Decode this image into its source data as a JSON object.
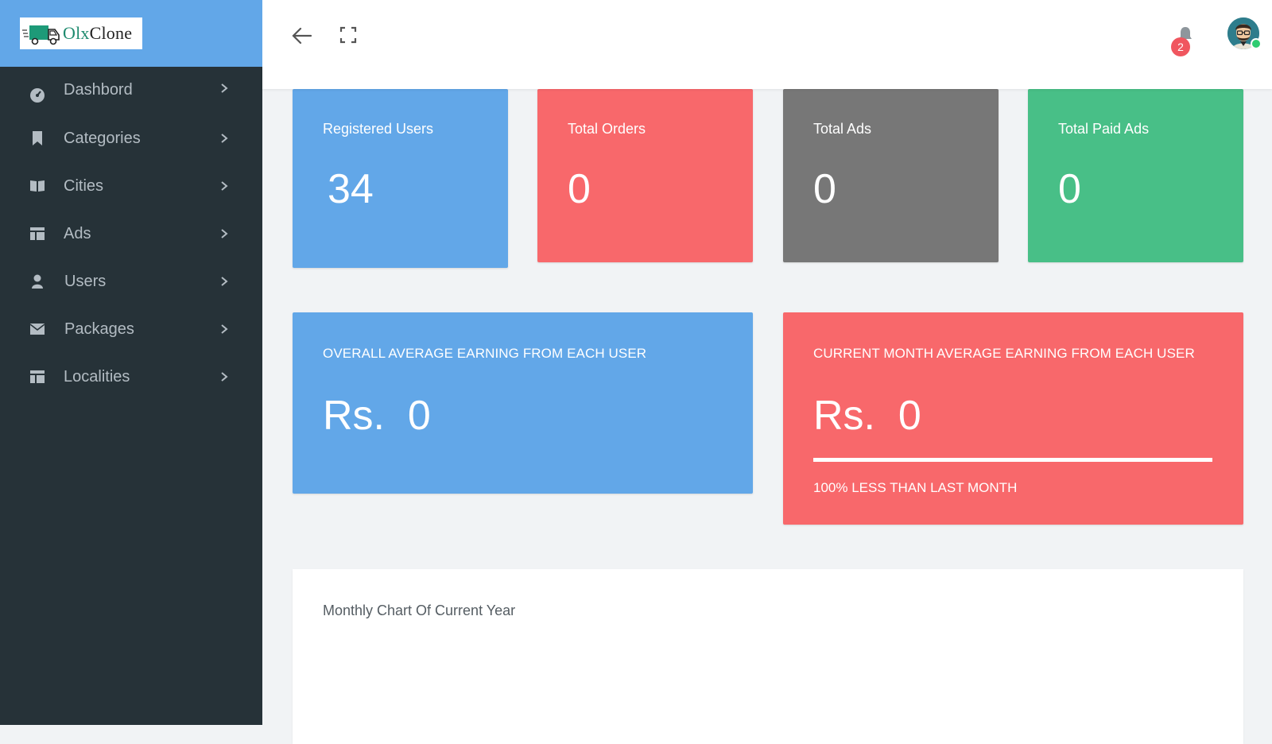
{
  "brand": {
    "name_part1": "Olx",
    "name_part2": "Clone"
  },
  "sidebar": {
    "items": [
      {
        "label": "Dashbord",
        "icon": "dashboard-icon"
      },
      {
        "label": "Categories",
        "icon": "bookmark-icon"
      },
      {
        "label": "Cities",
        "icon": "book-icon"
      },
      {
        "label": "Ads",
        "icon": "table-icon"
      },
      {
        "label": "Users",
        "icon": "user-icon"
      },
      {
        "label": "Packages",
        "icon": "envelope-icon"
      },
      {
        "label": "Localities",
        "icon": "table-icon"
      }
    ]
  },
  "header": {
    "notifications_count": "2"
  },
  "stats": [
    {
      "title": "Registered Users",
      "value": "34",
      "color": "#62a7e8"
    },
    {
      "title": "Total Orders",
      "value": "0",
      "color": "#f8686b"
    },
    {
      "title": "Total Ads",
      "value": "0",
      "color": "#777777"
    },
    {
      "title": "Total Paid Ads",
      "value": "0",
      "color": "#48bf87"
    }
  ],
  "earnings": {
    "overall": {
      "title": "OVERALL AVERAGE EARNING FROM EACH USER",
      "value": "Rs.  0",
      "color": "#62a7e8"
    },
    "current": {
      "title": "CURRENT MONTH AVERAGE EARNING FROM EACH USER",
      "value": "Rs.  0",
      "progress_percent": 100,
      "compare": "100% LESS THAN LAST MONTH",
      "color": "#f8686b"
    }
  },
  "chart_panel": {
    "title": "Monthly Chart Of Current Year"
  }
}
